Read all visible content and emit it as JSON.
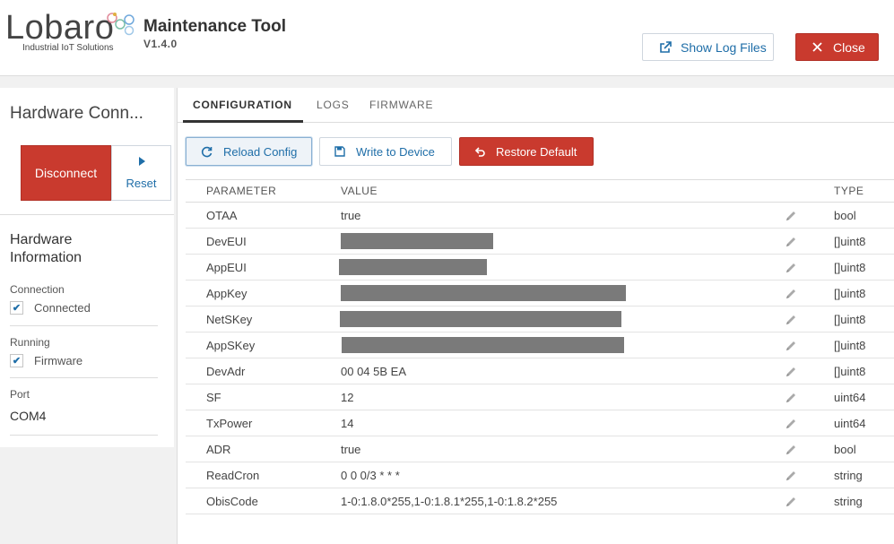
{
  "header": {
    "logo_word": "Lobaro",
    "logo_tagline": "Industrial IoT Solutions",
    "app_title": "Maintenance Tool",
    "app_version": "V1.4.0",
    "show_log_label": "Show Log Files",
    "close_label": "Close"
  },
  "sidebar": {
    "title": "Hardware Conn...",
    "disconnect_label": "Disconnect",
    "reset_label": "Reset",
    "info_title": "Hardware Information",
    "connection_label": "Connection",
    "connection_value": "Connected",
    "running_label": "Running",
    "running_value": "Firmware",
    "port_label": "Port",
    "port_value": "COM4"
  },
  "tabs": [
    {
      "label": "CONFIGURATION",
      "active": true
    },
    {
      "label": "LOGS",
      "active": false
    },
    {
      "label": "FIRMWARE",
      "active": false
    }
  ],
  "toolbar": {
    "reload_label": "Reload Config",
    "write_label": "Write to Device",
    "restore_label": "Restore Default"
  },
  "table": {
    "headers": {
      "parameter": "PARAMETER",
      "value": "VALUE",
      "type": "TYPE"
    },
    "rows": [
      {
        "param": "OTAA",
        "value": "true",
        "type": "bool",
        "redacted": false
      },
      {
        "param": "DevEUI",
        "value": "",
        "type": "[]uint8",
        "redacted": true
      },
      {
        "param": "AppEUI",
        "value": "",
        "type": "[]uint8",
        "redacted": true
      },
      {
        "param": "AppKey",
        "value": "",
        "type": "[]uint8",
        "redacted": true
      },
      {
        "param": "NetSKey",
        "value": "",
        "type": "[]uint8",
        "redacted": true
      },
      {
        "param": "AppSKey",
        "value": "",
        "type": "[]uint8",
        "redacted": true
      },
      {
        "param": "DevAdr",
        "value": "00 04 5B EA",
        "type": "[]uint8",
        "redacted": false
      },
      {
        "param": "SF",
        "value": "12",
        "type": "uint64",
        "redacted": false
      },
      {
        "param": "TxPower",
        "value": "14",
        "type": "uint64",
        "redacted": false
      },
      {
        "param": "ADR",
        "value": "true",
        "type": "bool",
        "redacted": false
      },
      {
        "param": "ReadCron",
        "value": "0 0 0/3 * * *",
        "type": "string",
        "redacted": false
      },
      {
        "param": "ObisCode",
        "value": "1-0:1.8.0*255,1-0:1.8.1*255,1-0:1.8.2*255",
        "type": "string",
        "redacted": false
      }
    ]
  },
  "colors": {
    "accent_blue": "#1f6ea8",
    "danger_red": "#c93a2e"
  }
}
